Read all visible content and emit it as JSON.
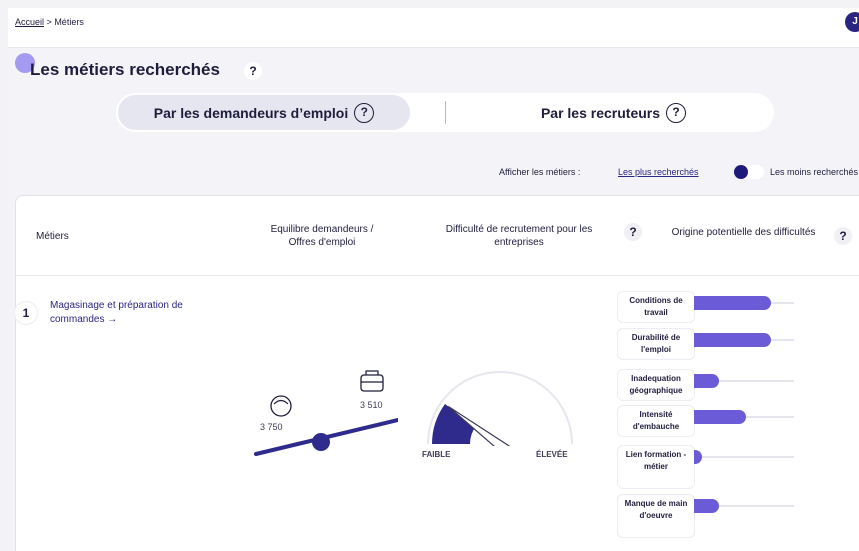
{
  "breadcrumb": {
    "home": "Accueil",
    "separator": ">",
    "current": "Métiers"
  },
  "user": {
    "avatar_letter": "J"
  },
  "page": {
    "title": "Les métiers recherchés",
    "help": "?"
  },
  "tabs": [
    {
      "label": "Par les demandeurs d’emploi",
      "help": "?",
      "active": true
    },
    {
      "label": "Par les recruteurs",
      "help": "?",
      "active": false
    }
  ],
  "filter": {
    "label": "Afficher les métiers :",
    "option_selected": "Les plus recherchés",
    "option_other": "Les moins recherchés",
    "toggle_on": false
  },
  "table": {
    "headers": {
      "metiers": "Métiers",
      "equilibre": "Equilibre demandeurs / Offres d'emploi",
      "difficulte": "Difficulté de recrutement pour les entreprises",
      "origine": "Origine potentielle des difficultés",
      "help": "?"
    },
    "rows": [
      {
        "rank": "1",
        "job": "Magasinage et préparation de commandes →",
        "demandeurs": "3 750",
        "offres": "3 510",
        "gauge": {
          "low": "FAIBLE",
          "high": "ÉLEVÉE",
          "level": 0.2
        },
        "origins": [
          {
            "label": "Conditions de travail",
            "value": 0.77
          },
          {
            "label": "Durabilité de l'emploi",
            "value": 0.77
          },
          {
            "label": "Inadequation géographique",
            "value": 0.25
          },
          {
            "label": "Intensité d'embauche",
            "value": 0.52
          },
          {
            "label": "Lien formation - métier",
            "value": 0.08
          },
          {
            "label": "Manque de main d'oeuvre",
            "value": 0.25
          }
        ]
      }
    ]
  },
  "colors": {
    "accent": "#2a2580",
    "bar": "#6b5bd6",
    "gauge": "#2f2b8c"
  }
}
